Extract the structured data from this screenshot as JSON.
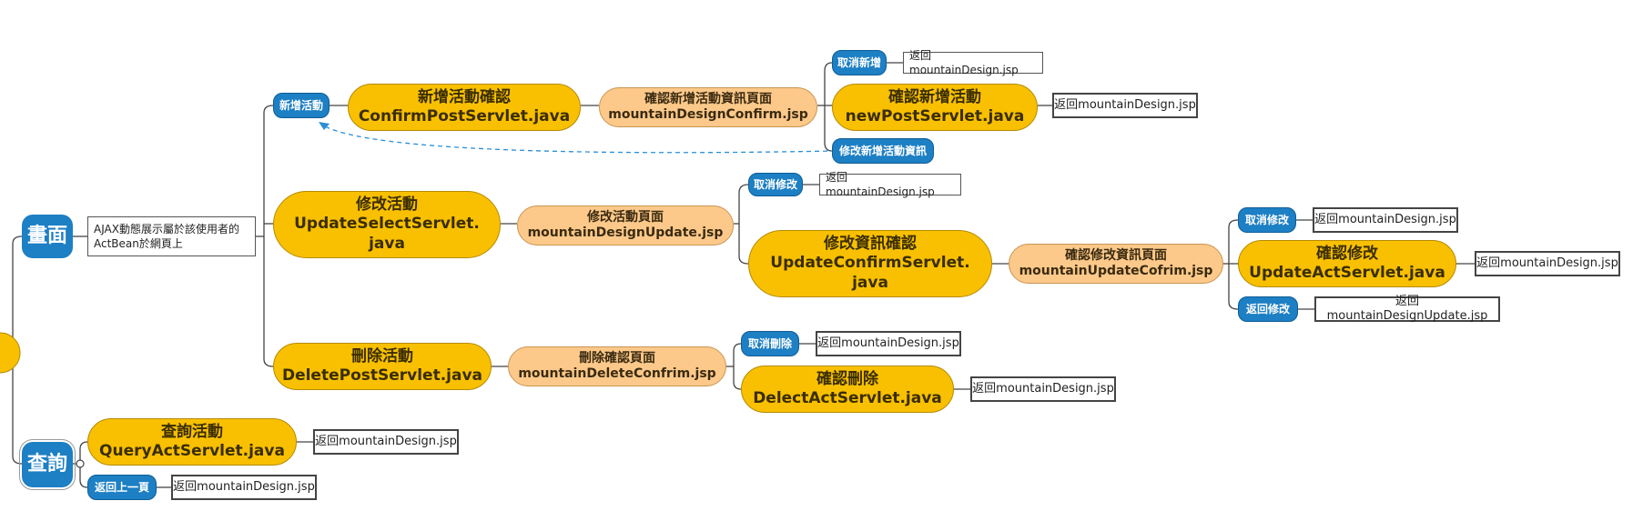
{
  "colors": {
    "orange": "#f8c000",
    "peach": "#fcc98a",
    "blue": "#1d7fc4",
    "line": "#444444",
    "dashed": "#2a8fd6"
  },
  "root": {
    "screen_label": "畫面",
    "query_label": "查詢",
    "ajax_note_line1": "AJAX動態展示屬於該使用者的",
    "ajax_note_line2": "ActBean於網頁上"
  },
  "add": {
    "tag": "新增活動",
    "confirm_l1": "新增活動確認",
    "confirm_l2": "ConfirmPostServlet.java",
    "page_l1": "確認新增活動資訊頁面",
    "page_l2": "mountainDesignConfirm.jsp",
    "cancel_tag": "取消新增",
    "cancel_return": "返回mountainDesign.jsp",
    "ok_l1": "確認新增活動",
    "ok_l2": "newPostServlet.java",
    "ok_return": "返回mountainDesign.jsp",
    "edit_tag": "修改新增活動資訊"
  },
  "update": {
    "l1": "修改活動",
    "l2": "UpdateSelectServlet.",
    "l3": "java",
    "page_l1": "修改活動頁面",
    "page_l2": "mountainDesignUpdate.jsp",
    "cancel_tag": "取消修改",
    "cancel_return": "返回mountainDesign.jsp",
    "confirm_l1": "修改資訊確認",
    "confirm_l2": "UpdateConfirmServlet.",
    "confirm_l3": "java",
    "cpage_l1": "確認修改資訊頁面",
    "cpage_l2": "mountainUpdateCofrim.jsp",
    "cancel2_tag": "取消修改",
    "cancel2_return": "返回mountainDesign.jsp",
    "ok_l1": "確認修改",
    "ok_l2": "UpdateActServlet.java",
    "ok_return": "返回mountainDesign.jsp",
    "back_tag": "返回修改",
    "back_return": "返回mountainDesignUpdate.jsp"
  },
  "delete": {
    "l1": "刪除活動",
    "l2": "DeletePostServlet.java",
    "page_l1": "刪除確認頁面",
    "page_l2": "mountainDeleteConfrim.jsp",
    "cancel_tag": "取消刪除",
    "cancel_return": "返回mountainDesign.jsp",
    "ok_l1": "確認刪除",
    "ok_l2": "DelectActServlet.java",
    "ok_return": "返回mountainDesign.jsp"
  },
  "query": {
    "l1": "查詢活動",
    "l2": "QueryActServlet.java",
    "return": "返回mountainDesign.jsp",
    "prev_tag": "返回上一頁",
    "prev_return": "返回mountainDesign.jsp"
  }
}
